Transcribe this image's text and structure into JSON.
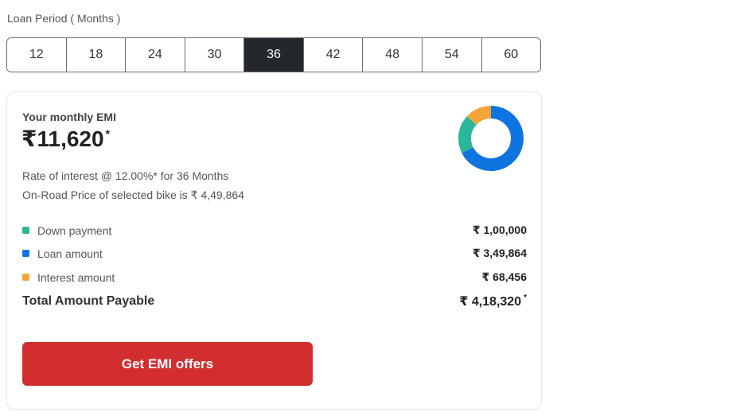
{
  "loan_period": {
    "label": "Loan Period ( Months )",
    "options": [
      "12",
      "18",
      "24",
      "30",
      "36",
      "42",
      "48",
      "54",
      "60"
    ],
    "selected": "36"
  },
  "emi": {
    "caption": "Your monthly EMI",
    "currency": "₹",
    "amount": "11,620",
    "asterisk": "*",
    "rate_line": "Rate of interest @ 12.00%* for 36 Months",
    "price_line": "On-Road Price of selected bike is ₹ 4,49,864"
  },
  "breakdown": {
    "down_payment": {
      "label": "Down payment",
      "value": "₹ 1,00,000",
      "color": "#2bb89a"
    },
    "loan_amount": {
      "label": "Loan amount",
      "value": "₹ 3,49,864",
      "color": "#0f74e0"
    },
    "interest_amount": {
      "label": "Interest amount",
      "value": "₹ 68,456",
      "color": "#f5a43a"
    },
    "total": {
      "label": "Total Amount Payable",
      "value": "₹ 4,18,320",
      "asterisk": "*"
    }
  },
  "donut_shares": {
    "down_payment": 100000,
    "loan_amount": 349864,
    "interest_amount": 68456
  },
  "cta": {
    "label": "Get EMI offers"
  }
}
